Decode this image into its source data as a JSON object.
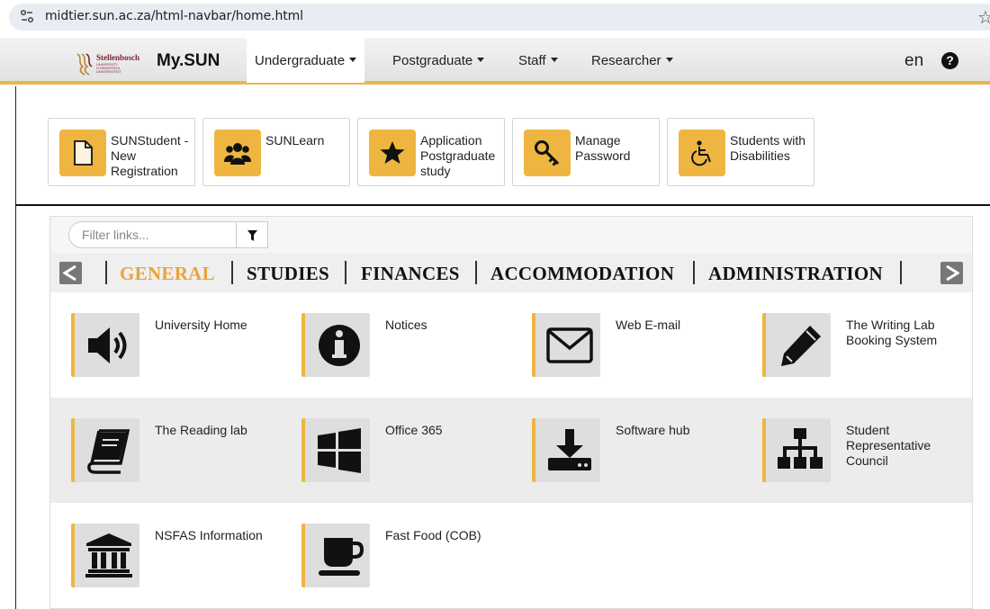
{
  "browser": {
    "url": "midtier.sun.ac.za/html-navbar/home.html"
  },
  "navbar": {
    "logo": {
      "word": "Stellenbosch",
      "sub": [
        "UNIVERSITY",
        "IYUNIVESITHI",
        "UNIVERSITEIT"
      ]
    },
    "brand": "My.SUN",
    "tabs": [
      {
        "label": "Undergraduate"
      },
      {
        "label": "Postgraduate"
      },
      {
        "label": "Staff"
      },
      {
        "label": "Researcher"
      }
    ],
    "language": "en",
    "help": "?"
  },
  "quick_links": [
    {
      "label": "SUNStudent - New Registration",
      "icon": "document-icon"
    },
    {
      "label": "SUNLearn",
      "icon": "group-icon"
    },
    {
      "label": "Application Postgraduate study",
      "icon": "star-icon"
    },
    {
      "label": "Manage Password",
      "icon": "key-icon"
    },
    {
      "label": "Students with Disabilities",
      "icon": "wheelchair-icon"
    }
  ],
  "filter": {
    "placeholder": "Filter links..."
  },
  "categories": [
    "GENERAL",
    "STUDIES",
    "FINANCES",
    "ACCOMMODATION",
    "ADMINISTRATION"
  ],
  "active_category": "GENERAL",
  "links": [
    {
      "label": "University Home",
      "icon": "speaker-icon"
    },
    {
      "label": "Notices",
      "icon": "info-icon"
    },
    {
      "label": "Web E-mail",
      "icon": "envelope-icon"
    },
    {
      "label": "The Writing Lab Booking System",
      "icon": "pencil-icon"
    },
    {
      "label": "The Reading lab",
      "icon": "book-icon"
    },
    {
      "label": "Office 365",
      "icon": "windows-icon"
    },
    {
      "label": "Software hub",
      "icon": "download-icon"
    },
    {
      "label": "Student Representative Council",
      "icon": "sitemap-icon"
    },
    {
      "label": "NSFAS Information",
      "icon": "bank-icon"
    },
    {
      "label": "Fast Food (COB)",
      "icon": "coffee-icon"
    }
  ],
  "colors": {
    "accent": "#eeb640",
    "active_category": "#e8a33b",
    "brand_maroon": "#7a2433"
  }
}
